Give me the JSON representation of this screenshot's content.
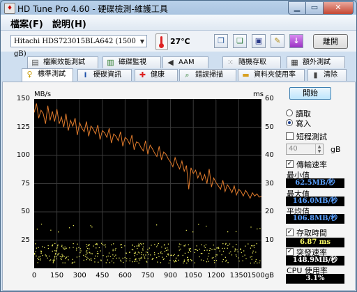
{
  "window": {
    "title": "HD Tune Pro 4.60 - 硬碟檢測-維護工具",
    "app_icon": "hd-tune-icon"
  },
  "menu": [
    "檔案(F)",
    "說明(H)"
  ],
  "toolbar": {
    "drive": "Hitachi HDS723015BLA642 (1500 gB)",
    "temperature": "27℃",
    "exit_label": "離開",
    "buttons": [
      "copy-text-icon",
      "copy-screen-icon",
      "save-icon",
      "options-icon",
      "download-icon"
    ]
  },
  "tabs_top": [
    {
      "label": "檔案效能測試",
      "icon": "file-benchmark-icon"
    },
    {
      "label": "磁碟監視",
      "icon": "disk-monitor-icon"
    },
    {
      "label": "AAM",
      "icon": "speaker-icon"
    },
    {
      "label": "隨機存取",
      "icon": "random-access-icon"
    },
    {
      "label": "額外測試",
      "icon": "extra-tests-icon"
    }
  ],
  "tabs_bottom": [
    {
      "label": "標準測試",
      "icon": "benchmark-icon",
      "active": true
    },
    {
      "label": "硬碟資訊",
      "icon": "info-icon"
    },
    {
      "label": "健康",
      "icon": "health-cross-icon"
    },
    {
      "label": "錯誤掃描",
      "icon": "error-scan-icon"
    },
    {
      "label": "資料夾使用率",
      "icon": "folder-icon"
    },
    {
      "label": "清除",
      "icon": "erase-icon"
    }
  ],
  "side": {
    "start_label": "開始",
    "read_label": "讀取",
    "write_label": "寫入",
    "write_selected": true,
    "short_test_label": "短程測試",
    "short_test_value": "40",
    "short_test_unit": "gB",
    "transfer_label": "傳輸速率",
    "min_label": "最小值",
    "min_value": "62.5MB/秒",
    "max_label": "最大值",
    "max_value": "146.0MB/秒",
    "avg_label": "平均值",
    "avg_value": "106.8MB/秒",
    "access_label": "存取時間",
    "access_value": "6.87 ms",
    "burst_label": "突發速率",
    "burst_value": "148.9MB/秒",
    "cpu_label": "CPU 使用率",
    "cpu_value": "3.1%"
  },
  "chart_data": {
    "type": "line+scatter",
    "y_left_unit": "MB/s",
    "y_right_unit": "ms",
    "y_left_ticks": [
      "150",
      "125",
      "100",
      "75",
      "50",
      "25"
    ],
    "y_right_ticks": [
      "60",
      "50",
      "40",
      "30",
      "20",
      "10"
    ],
    "x_ticks": [
      "0",
      "150",
      "300",
      "450",
      "600",
      "750",
      "900",
      "1050",
      "1200",
      "1350",
      "1500gB"
    ],
    "ylim_left": [
      0,
      150
    ],
    "ylim_right": [
      0,
      60
    ],
    "xlim": [
      0,
      1500
    ],
    "grid": true,
    "transfer_color": "#e07b2c",
    "access_color": "#e8e85a",
    "transfer_series": {
      "name": "傳輸速率",
      "x": [
        0,
        15,
        30,
        45,
        60,
        75,
        90,
        105,
        120,
        135,
        150,
        165,
        180,
        195,
        210,
        225,
        240,
        255,
        270,
        285,
        300,
        315,
        330,
        345,
        360,
        375,
        390,
        405,
        420,
        435,
        450,
        465,
        480,
        495,
        510,
        525,
        540,
        555,
        570,
        585,
        600,
        615,
        630,
        645,
        660,
        675,
        690,
        705,
        720,
        735,
        750,
        765,
        780,
        795,
        810,
        825,
        840,
        855,
        870,
        885,
        900,
        915,
        930,
        945,
        960,
        975,
        990,
        1005,
        1020,
        1035,
        1050,
        1065,
        1080,
        1095,
        1110,
        1125,
        1140,
        1155,
        1170,
        1185,
        1200,
        1215,
        1230,
        1245,
        1260,
        1275,
        1290,
        1305,
        1320,
        1335,
        1350,
        1365,
        1380,
        1395,
        1410,
        1425,
        1440,
        1455,
        1470,
        1485,
        1500
      ],
      "values": [
        138,
        146,
        133,
        140,
        137,
        128,
        144,
        131,
        139,
        130,
        141,
        128,
        134,
        125,
        137,
        122,
        131,
        126,
        133,
        118,
        129,
        124,
        121,
        130,
        117,
        126,
        123,
        119,
        127,
        114,
        122,
        120,
        116,
        124,
        111,
        119,
        117,
        113,
        121,
        108,
        116,
        114,
        110,
        118,
        105,
        112,
        111,
        107,
        104,
        113,
        101,
        109,
        106,
        102,
        99,
        108,
        96,
        103,
        101,
        97,
        94,
        90,
        98,
        92,
        88,
        95,
        86,
        91,
        70,
        89,
        84,
        87,
        80,
        85,
        78,
        83,
        75,
        88,
        72,
        80,
        76,
        73,
        70,
        78,
        68,
        74,
        71,
        67,
        73,
        65,
        70,
        68,
        64,
        69,
        66,
        62,
        67,
        64,
        66,
        63,
        64
      ]
    },
    "access_series": {
      "name": "存取時間",
      "band_ms": [
        2,
        9
      ],
      "outliers_ms": [
        13,
        16
      ]
    }
  }
}
